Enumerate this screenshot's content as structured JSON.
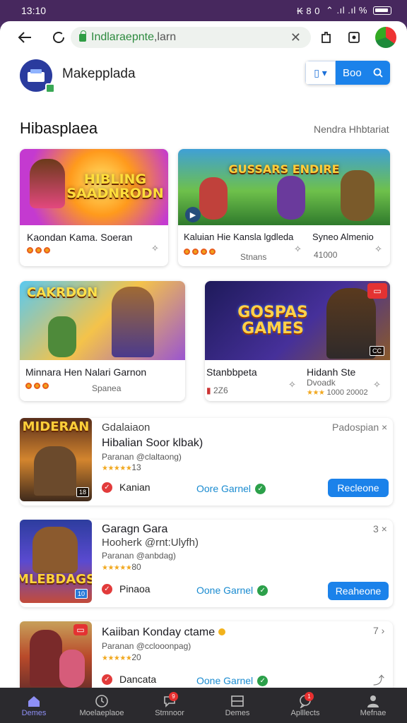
{
  "status_bar": {
    "time": "13:10",
    "indicators": "₭ 8 0",
    "signal": "⌃ .ıl .ıl %"
  },
  "browser": {
    "url_domain": "Indlaraepnte",
    "url_rest": ",larn"
  },
  "header": {
    "app_name": "Makepplada",
    "search_label": "Boo"
  },
  "section": {
    "title": "Hibasplaea",
    "link": "Nendra Hhbtariat"
  },
  "featured": [
    {
      "thumb_title": "HIBLING SAADNRODN",
      "title": "Kaondan  Kama.  Soeran",
      "color_top": "#c23bd6",
      "color_bottom": "#ffb21c"
    },
    {
      "thumb_title": "GUSSARS ENDIRE",
      "title": "Kaluian Hie Kansla lgdleda",
      "sub": "Stnans",
      "title2": "Syneo Almenio",
      "sub2": "41000"
    },
    {
      "thumb_title": "CAKRDON",
      "title": "Minnara Hen Nalari Garnon",
      "sub": "Spanea"
    },
    {
      "thumb_title": "GOSPAS GAMES",
      "title": "Stanbbpeta",
      "sub": "2Z6",
      "title2": "Hidanh Ste",
      "sub2": "Dvoadk",
      "sub3": "1000 20002"
    }
  ],
  "list": [
    {
      "thumb_title": "MIDERAN",
      "title": "Gdalaiaon",
      "title2": "Hibalian Soor klbak)",
      "sub": "Paranan @claltaong)",
      "rating": "13",
      "category": "Kanian",
      "link": "Oore Garnel",
      "right": "Padospian ×",
      "button": "Recleone"
    },
    {
      "thumb_title": "MLEBDAGS",
      "title": "Garagn Gara",
      "title2": "Hooherk @rnt:Ulyfh)",
      "sub": "Paranan @anbdag)",
      "rating": "80",
      "category": "Pinaoa",
      "link": "Oone Garnel",
      "right": "3 ×",
      "button": "Reaheone"
    },
    {
      "thumb_title": "",
      "title": "Kaiiban Konday ctame",
      "sub": "Paranan @cclooonpag)",
      "rating": "20",
      "category": "Dancata",
      "link": "Oone Garnel",
      "right": "7 ›"
    }
  ],
  "nav": [
    {
      "label": "Demes",
      "icon": "home-icon"
    },
    {
      "label": "Moelaeplaoe",
      "icon": "clock-icon"
    },
    {
      "label": "Stmnoor",
      "icon": "chat-icon",
      "badge": "9"
    },
    {
      "label": "Demes",
      "icon": "grid-icon"
    },
    {
      "label": "Aplllects",
      "icon": "message-icon",
      "badge": "1"
    },
    {
      "label": "Mefnae",
      "icon": "person-icon"
    }
  ],
  "colors": {
    "accent": "#1b82ea",
    "status_bar": "#47285e",
    "nav_bg": "#2b2a2e",
    "active_nav": "#8e8ff5"
  }
}
